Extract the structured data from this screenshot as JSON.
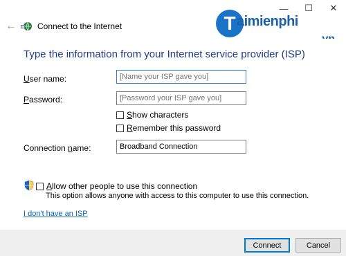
{
  "window": {
    "title": "Connect to the Internet",
    "controls": [
      "—",
      "☐",
      "✕"
    ]
  },
  "watermark": {
    "logo_letter": "T",
    "word": "aimienphi",
    "suffix": ".vn"
  },
  "main": {
    "heading": "Type the information from your Internet service provider (ISP)",
    "username_label_underlined": "U",
    "username_label_rest": "ser name:",
    "username_placeholder": "[Name your ISP gave you]",
    "password_label_underlined": "P",
    "password_label_rest": "assword:",
    "password_placeholder": "[Password your ISP gave you]",
    "show_characters_underlined": "S",
    "show_characters_rest": "how characters",
    "remember_password_underlined": "R",
    "remember_password_rest": "emember this password",
    "connection_name_label_rest1": "Connection ",
    "connection_name_label_underlined": "n",
    "connection_name_label_rest2": "ame:",
    "connection_name_value": "Broadband Connection",
    "allow_others_underlined": "A",
    "allow_others_rest": "llow other people to use this connection",
    "allow_others_info": "This option allows anyone with access to this computer to use this connection.",
    "no_isp_underlined": "I",
    "no_isp_before": "",
    "no_isp_link": "I don't have an ISP"
  },
  "footer": {
    "connect_button": "Connect",
    "cancel_button": "Cancel"
  },
  "colors": {
    "heading": "#1e3a8a",
    "link": "#0b5fb8",
    "primary_border": "#0078d7"
  }
}
